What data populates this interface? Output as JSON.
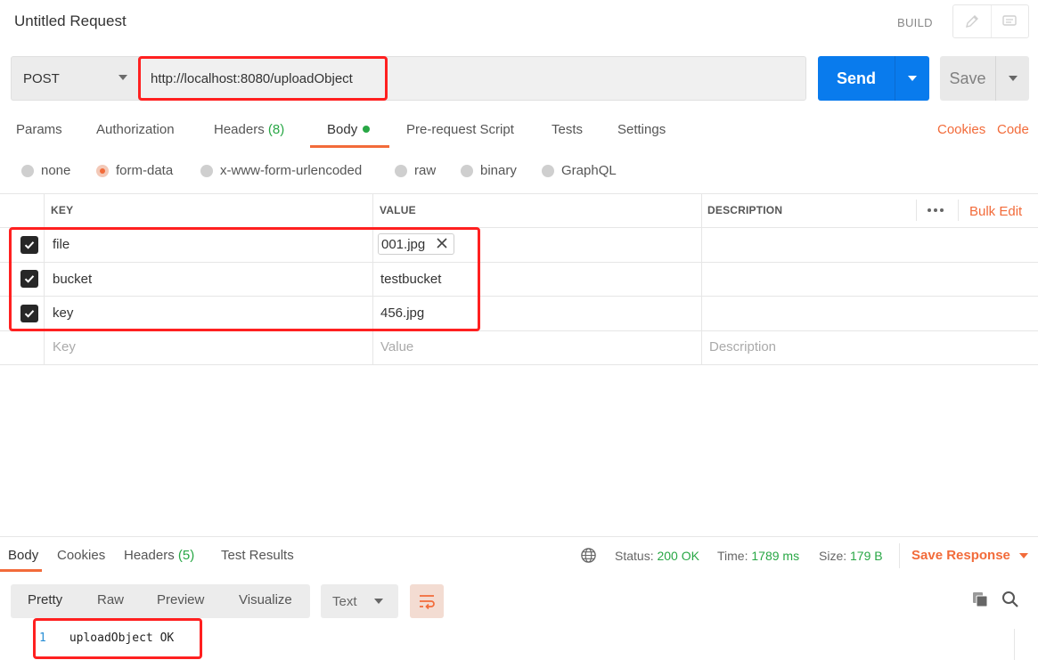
{
  "header": {
    "title": "Untitled Request",
    "build_label": "BUILD"
  },
  "request": {
    "method": "POST",
    "url": "http://localhost:8080/uploadObject",
    "send_label": "Send",
    "save_label": "Save"
  },
  "tabs": [
    {
      "label": "Params"
    },
    {
      "label": "Authorization"
    },
    {
      "label": "Headers",
      "count": "(8)"
    },
    {
      "label": "Body"
    },
    {
      "label": "Pre-request Script"
    },
    {
      "label": "Tests"
    },
    {
      "label": "Settings"
    }
  ],
  "links": {
    "cookies": "Cookies",
    "code": "Code"
  },
  "body_modes": [
    {
      "label": "none"
    },
    {
      "label": "form-data",
      "selected": true
    },
    {
      "label": "x-www-form-urlencoded"
    },
    {
      "label": "raw"
    },
    {
      "label": "binary"
    },
    {
      "label": "GraphQL"
    }
  ],
  "table": {
    "headers": {
      "key": "KEY",
      "value": "VALUE",
      "description": "DESCRIPTION"
    },
    "bulk_edit": "Bulk Edit",
    "rows": [
      {
        "key": "file",
        "value": "001.jpg",
        "checked": true,
        "type": "file"
      },
      {
        "key": "bucket",
        "value": "testbucket",
        "checked": true
      },
      {
        "key": "key",
        "value": "456.jpg",
        "checked": true
      }
    ],
    "placeholder": {
      "key": "Key",
      "value": "Value",
      "description": "Description"
    }
  },
  "response": {
    "tabs": [
      {
        "label": "Body"
      },
      {
        "label": "Cookies"
      },
      {
        "label": "Headers",
        "count": "(5)"
      },
      {
        "label": "Test Results"
      }
    ],
    "status_label": "Status:",
    "status_value": "200 OK",
    "time_label": "Time:",
    "time_value": "1789 ms",
    "size_label": "Size:",
    "size_value": "179 B",
    "save_response": "Save Response",
    "formats": [
      "Pretty",
      "Raw",
      "Preview",
      "Visualize"
    ],
    "language": "Text",
    "code": {
      "line": "1",
      "text": "uploadObject OK"
    }
  },
  "colors": {
    "accent": "#f26b3a",
    "send": "#097bed",
    "success": "#28a745",
    "highlight": "#ff2020"
  }
}
